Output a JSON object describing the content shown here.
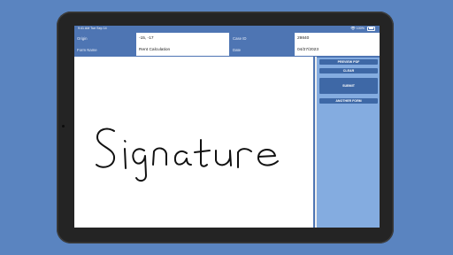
{
  "status": {
    "time": "9:41 AM",
    "date": "Tue Sep 14",
    "battery": "100%"
  },
  "form": {
    "origin_label": "Origin",
    "origin_value": "-15, -17",
    "form_name_label": "Form Name",
    "form_name_value": "Rent Calculation",
    "case_id_label": "Case ID",
    "case_id_value": "29840",
    "date_label": "Date",
    "date_value": "04/27/2023"
  },
  "canvas": {
    "signature_text": "Signature",
    "ink_color": "#111111"
  },
  "sidebar": {
    "preview_pdf_label": "PREVIEW PDF",
    "clear_label": "CLEAR",
    "submit_label": "SUBMIT",
    "another_form_label": "ANOTHER FORM"
  },
  "colors": {
    "background": "#5a84c0",
    "header": "#4e75b3",
    "sidebar": "#84ace0",
    "button": "#3e68a6"
  }
}
